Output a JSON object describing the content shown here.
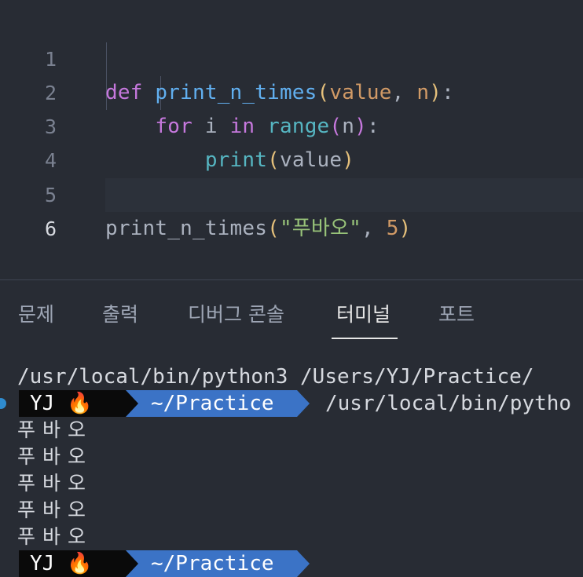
{
  "editor": {
    "line_numbers": [
      "1",
      "2",
      "3",
      "4",
      "5",
      "6"
    ],
    "lines": {
      "l1": {
        "kw": "def",
        "fn": "print_n_times",
        "open": "(",
        "p1": "value",
        "comma": ", ",
        "p2": "n",
        "close": ")",
        "colon": ":"
      },
      "l2": {
        "kw": "for",
        "var": "i",
        "kw2": "in",
        "builtin": "range",
        "open": "(",
        "arg": "n",
        "close": ")",
        "colon": ":"
      },
      "l3": {
        "builtin": "print",
        "open": "(",
        "arg": "value",
        "close": ")"
      },
      "l5": {
        "fn": "print_n_times",
        "open": "(",
        "str": "\"푸바오\"",
        "comma": ", ",
        "num": "5",
        "close": ")"
      }
    }
  },
  "panel": {
    "tabs": [
      "문제",
      "출력",
      "디버그 콘솔",
      "터미널",
      "포트"
    ],
    "active_tab": "터미널"
  },
  "terminal": {
    "command_line": "/usr/local/bin/python3 /Users/YJ/Practice/",
    "prompt_user": "YJ",
    "prompt_icon": "🔥",
    "prompt_path": "~/Practice",
    "prompt_command": "/usr/local/bin/pytho",
    "output": [
      "푸바오",
      "푸바오",
      "푸바오",
      "푸바오",
      "푸바오"
    ],
    "prompt2_user": "YJ",
    "prompt2_path": "~/Practice"
  },
  "colors": {
    "background": "#282c34",
    "keyword": "#c678dd",
    "function": "#61afef",
    "string": "#98c379",
    "prompt_path_bg": "#3b73c6"
  }
}
